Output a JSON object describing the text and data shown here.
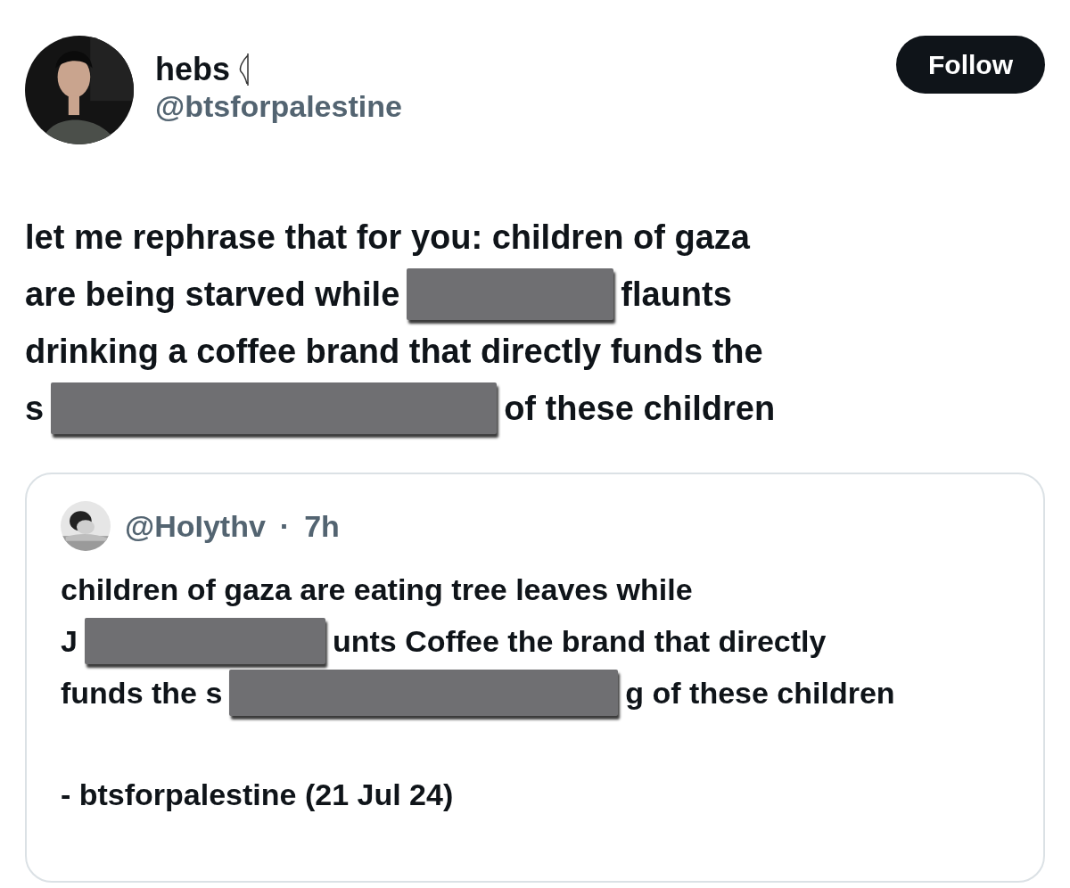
{
  "author": {
    "name": "hebs",
    "handle": "@btsforpalestine",
    "avatar": {
      "kind": "picture"
    }
  },
  "follow_button": {
    "label": "Follow"
  },
  "tweet_lines": [
    [
      {
        "kind": "text",
        "text": "let me rephrase that for you: children of gaza"
      }
    ],
    [
      {
        "kind": "text",
        "text": "are being starved while"
      },
      {
        "kind": "redaction"
      },
      {
        "kind": "text",
        "text": "flaunts"
      }
    ],
    [
      {
        "kind": "text",
        "text": "drinking a coffee brand that directly funds the"
      }
    ],
    [
      {
        "kind": "text",
        "text": "s"
      },
      {
        "kind": "redaction"
      },
      {
        "kind": "text",
        "text": "of these children"
      }
    ]
  ],
  "quote": {
    "handle": "@HoIythv",
    "separator": "·",
    "time": "7h",
    "avatar": {
      "kind": "picture"
    },
    "lines": [
      [
        {
          "kind": "text",
          "text": "children of gaza are eating tree leaves while"
        }
      ],
      [
        {
          "kind": "text",
          "text": "J"
        },
        {
          "kind": "redaction"
        },
        {
          "kind": "text",
          "text": "unts Coffee the brand that directly"
        }
      ],
      [
        {
          "kind": "text",
          "text": "funds the s"
        },
        {
          "kind": "redaction"
        },
        {
          "kind": "text",
          "text": "g of these children"
        }
      ]
    ],
    "signature": "- btsforpalestine (21 Jul 24)"
  }
}
